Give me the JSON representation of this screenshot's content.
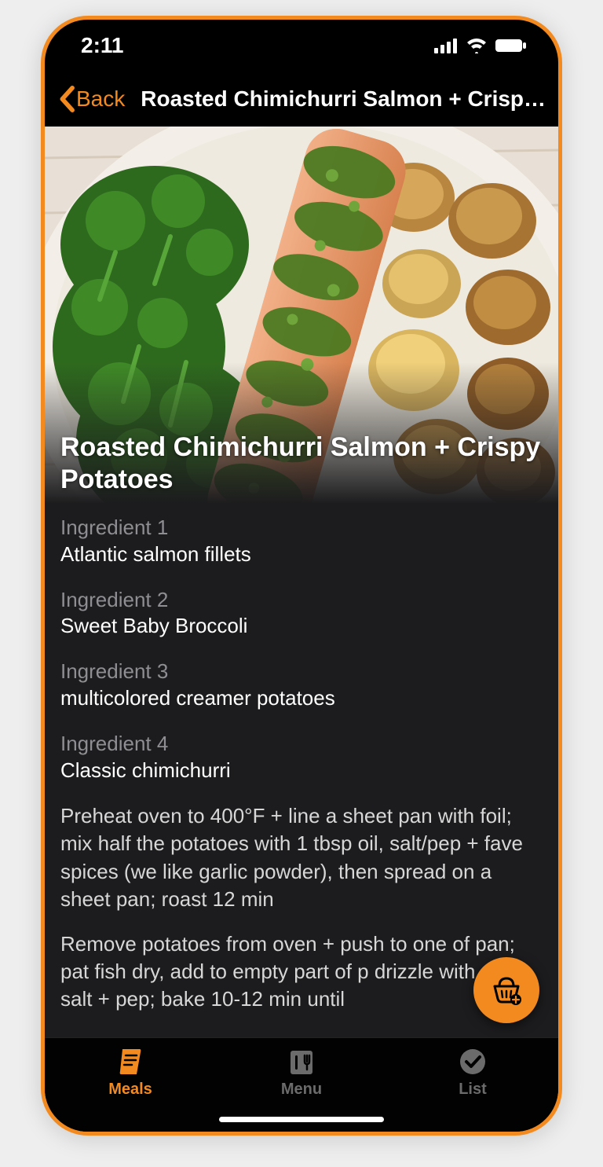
{
  "colors": {
    "accent": "#f28a1f",
    "panel": "#1c1c1e"
  },
  "status": {
    "time": "2:11"
  },
  "nav": {
    "back_label": "Back",
    "title": "Roasted Chimichurri Salmon + Crispy ..."
  },
  "hero": {
    "title": "Roasted Chimichurri Salmon + Crispy Potatoes"
  },
  "ingredients": [
    {
      "label": "Ingredient 1",
      "value": "Atlantic salmon fillets"
    },
    {
      "label": "Ingredient 2",
      "value": "Sweet Baby Broccoli"
    },
    {
      "label": "Ingredient 3",
      "value": "multicolored creamer potatoes"
    },
    {
      "label": "Ingredient 4",
      "value": "Classic chimichurri"
    }
  ],
  "steps": [
    "Preheat oven to 400°F + line a sheet pan with foil; mix half the potatoes with 1 tbsp oil, salt/pep + fave spices (we like garlic powder), then spread on a sheet pan; roast 12 min",
    "Remove potatoes from oven + push to one of pan; pat fish dry, add to empty part of p drizzle with oil, salt + pep; bake 10-12 min until"
  ],
  "fab": {
    "icon": "basket-add-icon"
  },
  "tabs": [
    {
      "label": "Meals",
      "icon": "receipt-icon",
      "active": true
    },
    {
      "label": "Menu",
      "icon": "menu-fork-icon",
      "active": false
    },
    {
      "label": "List",
      "icon": "checkmark-circle-icon",
      "active": false
    }
  ]
}
